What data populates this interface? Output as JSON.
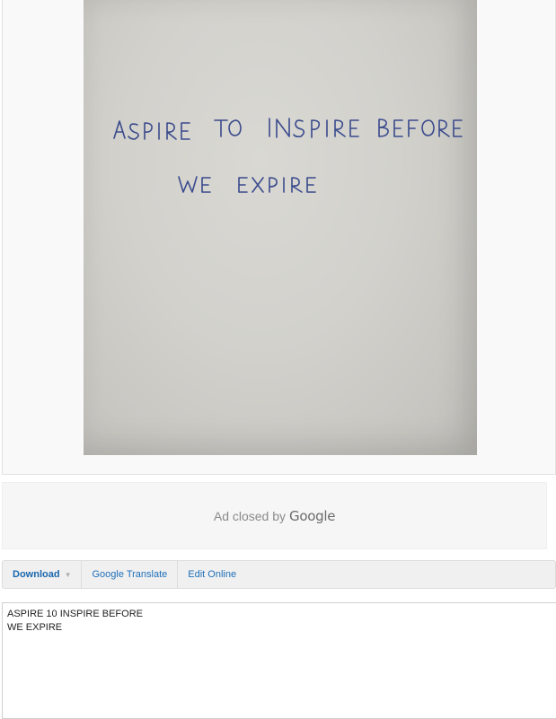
{
  "image": {
    "handwritten_lines": [
      "ASPIRE TO INSPIRE BEFORE",
      "WE EXPIRE"
    ],
    "ink_color": "#3a4a8c",
    "paper_color": "#d2d1cc"
  },
  "ad": {
    "text": "Ad closed by",
    "brand": "Google"
  },
  "toolbar": {
    "download_label": "Download",
    "translate_label": "Google Translate",
    "edit_label": "Edit Online"
  },
  "output": {
    "text": "ASPIRE 10 INSPIRE BEFORE\nWE EXPIRE"
  },
  "colors": {
    "link": "#1f6fb8",
    "toolbar_bg": "#f0f0f0"
  }
}
